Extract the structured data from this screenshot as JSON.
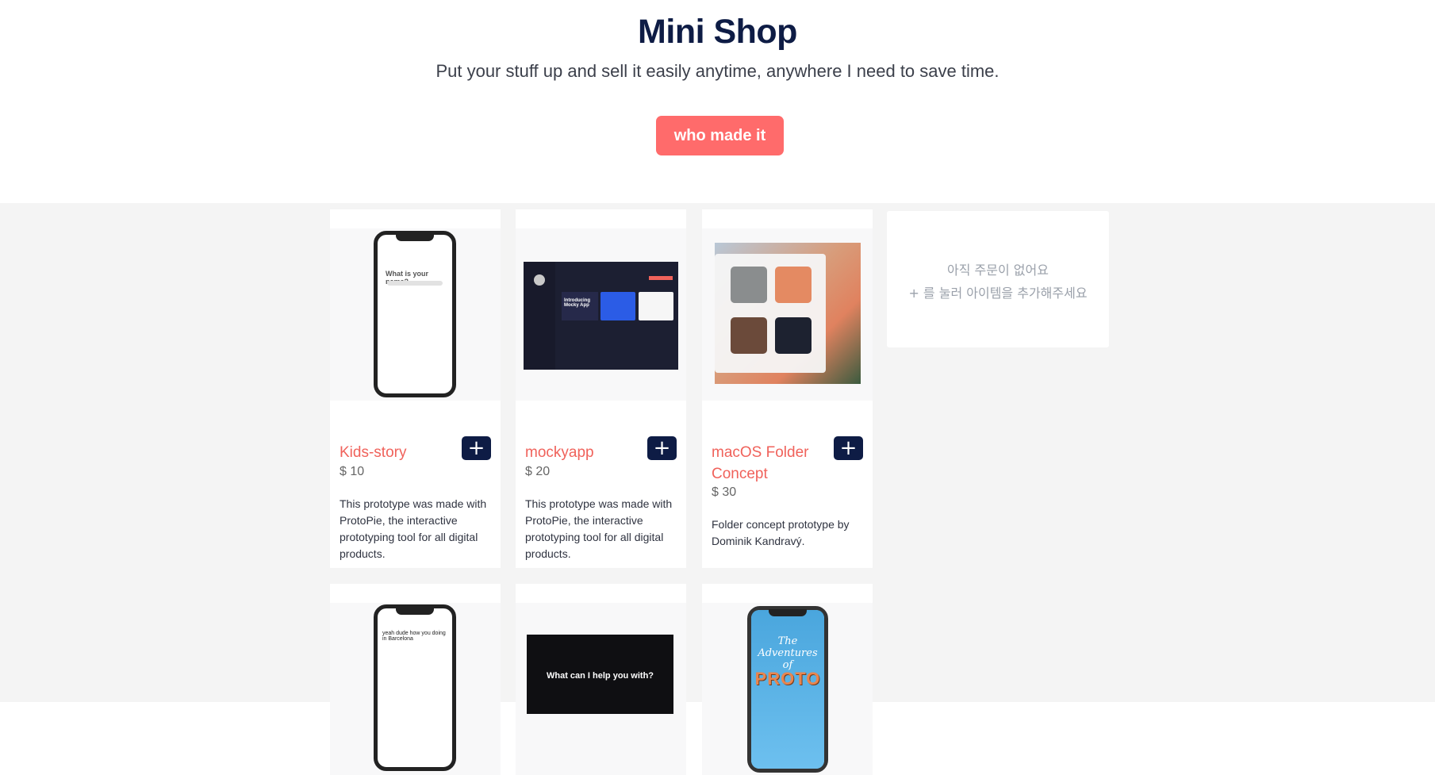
{
  "header": {
    "title": "Mini Shop",
    "subtitle": "Put your stuff up and sell it easily anytime, anywhere I need to save time.",
    "cta_label": "who made it"
  },
  "products": [
    {
      "title": "Kids-story",
      "price": "$ 10",
      "description": "This prototype was made with ProtoPie, the interactive prototyping tool for all digital products.",
      "thumb_text": "What is your name?"
    },
    {
      "title": "mockyapp",
      "price": "$ 20",
      "description": "This prototype was made with ProtoPie, the interactive prototyping tool for all digital products.",
      "thumb_text": "Introducing Mocky App"
    },
    {
      "title": "macOS Folder Concept",
      "price": "$ 30",
      "description": "Folder concept prototype by Dominik Kandravý."
    },
    {
      "title": "",
      "price": "",
      "description": "",
      "thumb_text": "yeah dude how you doing in Barcelona"
    },
    {
      "title": "",
      "price": "",
      "description": "",
      "thumb_text": "What can I help you with?"
    },
    {
      "title": "",
      "price": "",
      "description": "",
      "thumb_text": "PROTO",
      "thumb_script": "The Adventures of"
    }
  ],
  "cart": {
    "empty_line1": "아직 주문이 없어요",
    "empty_line2": "+ 를 눌러 아이템을 추가해주세요"
  },
  "icons": {
    "add": "plus-icon"
  },
  "colors": {
    "accent": "#f0625b",
    "cta": "#ff6b6b",
    "navy": "#0e1c45",
    "background": "#f4f4f4"
  }
}
